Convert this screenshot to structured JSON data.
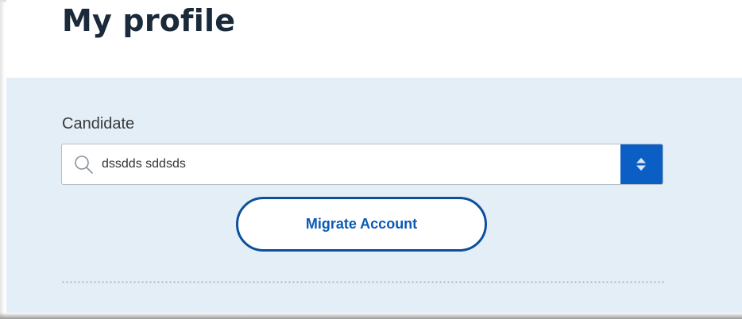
{
  "header": {
    "title": "My profile"
  },
  "form": {
    "candidate_label": "Candidate",
    "candidate_value": "dssdds sddsds",
    "search_icon": "search-icon",
    "stepper_icon": "chevron-up-down-icon",
    "migrate_label": "Migrate Account"
  },
  "colors": {
    "title": "#1a2a3a",
    "panel_background": "#e3eef7",
    "accent": "#0b5ec3",
    "button_border": "#0d4f9e",
    "button_text": "#0b5ab3"
  }
}
